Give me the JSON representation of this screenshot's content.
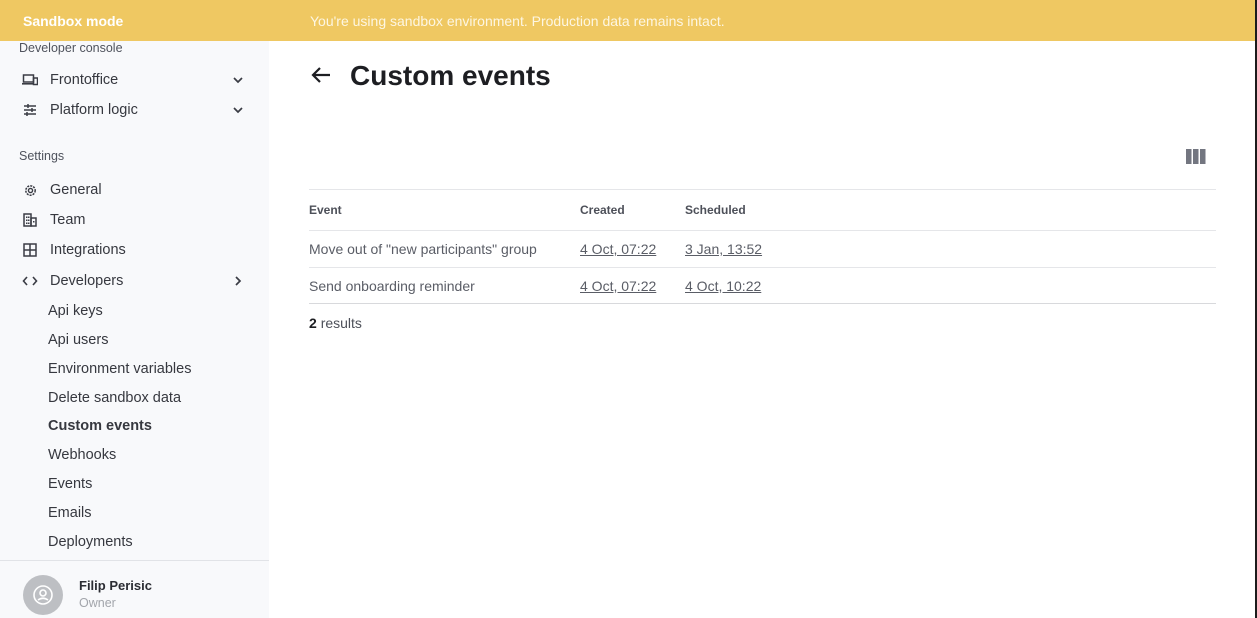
{
  "banner": {
    "title": "Sandbox mode",
    "message": "You're using sandbox environment. Production data remains intact.",
    "color": "#efc862"
  },
  "sidebar": {
    "developer_console_label": "Developer console",
    "console_items": [
      {
        "label": "Frontoffice",
        "icon": "devices-icon",
        "expand": "chevron-down"
      },
      {
        "label": "Platform logic",
        "icon": "sliders-icon",
        "expand": "chevron-down"
      }
    ],
    "settings_label": "Settings",
    "settings_items": [
      {
        "label": "General",
        "icon": "gear-icon"
      },
      {
        "label": "Team",
        "icon": "building-icon"
      },
      {
        "label": "Integrations",
        "icon": "grid-icon"
      },
      {
        "label": "Developers",
        "icon": "code-icon",
        "expand": "chevron-right"
      }
    ],
    "developer_subitems": [
      {
        "label": "Api keys",
        "active": false
      },
      {
        "label": "Api users",
        "active": false
      },
      {
        "label": "Environment variables",
        "active": false
      },
      {
        "label": "Delete sandbox data",
        "active": false
      },
      {
        "label": "Custom events",
        "active": true
      },
      {
        "label": "Webhooks",
        "active": false
      },
      {
        "label": "Events",
        "active": false
      },
      {
        "label": "Emails",
        "active": false
      },
      {
        "label": "Deployments",
        "active": false
      }
    ],
    "user": {
      "name": "Filip Perisic",
      "role": "Owner"
    }
  },
  "main": {
    "title": "Custom events",
    "table": {
      "columns": [
        "Event",
        "Created",
        "Scheduled"
      ],
      "rows": [
        {
          "event": "Move out of \"new participants\" group",
          "created": "4 Oct, 07:22",
          "scheduled": "3 Jan, 13:52"
        },
        {
          "event": "Send onboarding reminder",
          "created": "4 Oct, 07:22",
          "scheduled": "4 Oct, 10:22"
        }
      ]
    },
    "results_count": "2",
    "results_label": "results"
  }
}
